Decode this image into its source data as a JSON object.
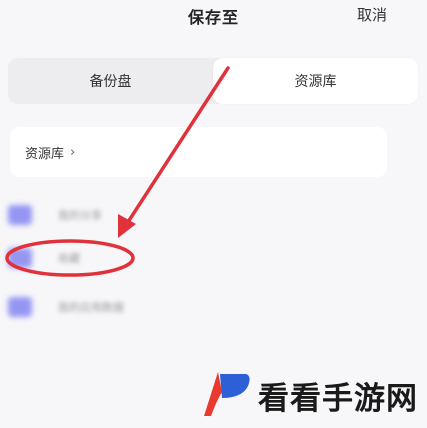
{
  "header": {
    "title": "保存至",
    "cancel_label": "取消"
  },
  "tabs": [
    {
      "label": "备份盘",
      "active": false
    },
    {
      "label": "资源库",
      "active": true
    }
  ],
  "breadcrumb": {
    "label": "资源库",
    "chevron": "›"
  },
  "folders": [
    {
      "name": "我的分享",
      "icon": "folder-icon"
    },
    {
      "name": "收藏",
      "icon": "folder-icon"
    },
    {
      "name": "我的应用数据",
      "icon": "folder-icon"
    }
  ],
  "annotation": {
    "color": "#e0323a",
    "arrow_label": "",
    "highlight": "ellipse around second folder"
  },
  "watermark": {
    "text": "看看手游网",
    "logo_colors": [
      "#e83a2f",
      "#2d5fd6"
    ]
  }
}
